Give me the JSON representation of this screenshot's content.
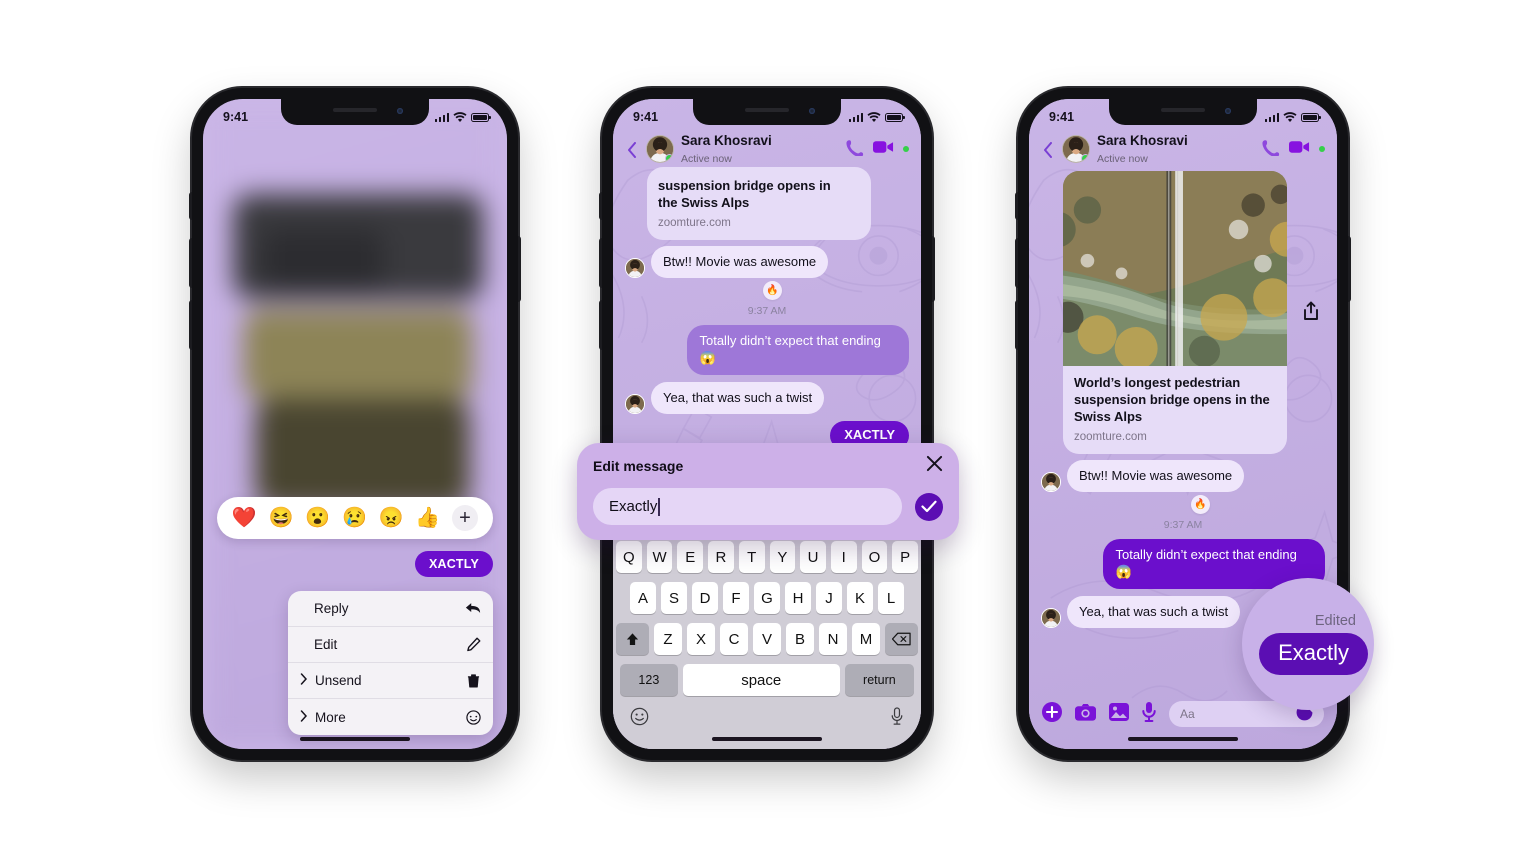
{
  "status_bar": {
    "time": "9:41",
    "signal_icon": "cellular-bars-icon",
    "wifi_icon": "wifi-icon",
    "battery_icon": "battery-icon"
  },
  "contact": {
    "name": "Sara Khosravi",
    "status": "Active now"
  },
  "header_actions": {
    "back_icon": "back-chevron-icon",
    "call_icon": "phone-call-icon",
    "video_icon": "video-camera-icon"
  },
  "phone1": {
    "reactions": [
      {
        "name": "heart-reaction",
        "glyph": "❤️"
      },
      {
        "name": "laugh-reaction",
        "glyph": "😆"
      },
      {
        "name": "wow-reaction",
        "glyph": "😮"
      },
      {
        "name": "sad-reaction",
        "glyph": "😢"
      },
      {
        "name": "angry-reaction",
        "glyph": "😠"
      },
      {
        "name": "thumbsup-reaction",
        "glyph": "👍"
      }
    ],
    "add_reaction_label": "+",
    "selected_message": "XACTLY",
    "menu": [
      {
        "label": "Reply",
        "icon": "reply-arrow-icon",
        "has_chevron": false
      },
      {
        "label": "Edit",
        "icon": "pencil-icon",
        "has_chevron": false
      },
      {
        "label": "Unsend",
        "icon": "trash-icon",
        "has_chevron": true
      },
      {
        "label": "More",
        "icon": "more-circle-icon",
        "has_chevron": true
      }
    ]
  },
  "phone2": {
    "link_card": {
      "title_line1": "suspension bridge opens in",
      "title_line2": "the Swiss Alps",
      "url": "zoomture.com"
    },
    "messages": [
      {
        "from": "them",
        "text": "Btw!! Movie was awesome",
        "reaction": "🔥"
      },
      {
        "from": "me",
        "text": "Totally didn’t expect that ending 😱"
      },
      {
        "from": "them",
        "text": "Yea, that was such a twist"
      },
      {
        "from": "me",
        "text": "XACTLY"
      }
    ],
    "timestamp": "9:37 AM",
    "edit_dialog": {
      "title": "Edit message",
      "close_icon": "close-x-icon",
      "input_value": "Exactly",
      "confirm_icon": "check-circle-icon"
    },
    "keyboard": {
      "row1": [
        "Q",
        "W",
        "E",
        "R",
        "T",
        "Y",
        "U",
        "I",
        "O",
        "P"
      ],
      "row2": [
        "A",
        "S",
        "D",
        "F",
        "G",
        "H",
        "J",
        "K",
        "L"
      ],
      "row3": [
        "Z",
        "X",
        "C",
        "V",
        "B",
        "N",
        "M"
      ],
      "shift_icon": "shift-arrow-icon",
      "backspace_icon": "backspace-icon",
      "numbers_key": "123",
      "space_key": "space",
      "return_key": "return",
      "emoji_icon": "emoji-smiley-icon",
      "mic_icon": "microphone-icon"
    }
  },
  "phone3": {
    "link_card": {
      "title": "World’s longest pedestrian suspension bridge opens in the Swiss Alps",
      "url": "zoomture.com"
    },
    "share_icon": "share-upload-icon",
    "messages": [
      {
        "from": "them",
        "text": "Btw!! Movie was awesome",
        "reaction": "🔥"
      },
      {
        "from": "me",
        "text": "Totally didn’t expect that ending 😱"
      },
      {
        "from": "them",
        "text": "Yea, that was such a twist"
      }
    ],
    "timestamp": "9:37 AM",
    "loupe": {
      "edited_label": "Edited",
      "message": "Exactly"
    },
    "composer": {
      "plus_icon": "plus-circle-icon",
      "camera_icon": "camera-icon",
      "gallery_icon": "photo-gallery-icon",
      "mic_icon": "microphone-icon",
      "input_placeholder": "Aa",
      "sticker_icon": "sticker-icon"
    }
  },
  "colors": {
    "brand_purple": "#6b0fcc",
    "deep_purple": "#5b0eb3",
    "bubble_out": "#9e77d8",
    "bubble_in": "#efe6fb",
    "wallpaper": "#c9b5e6",
    "online_green": "#35d04a"
  }
}
